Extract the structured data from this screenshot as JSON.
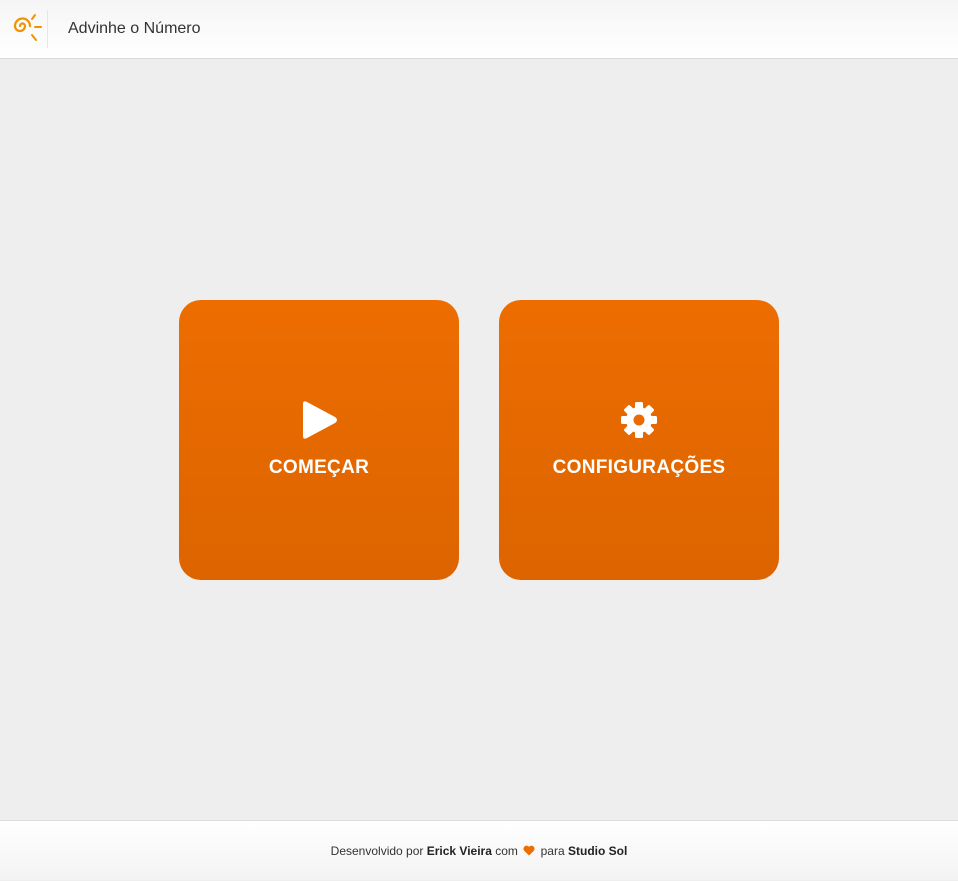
{
  "header": {
    "logo_icon": "sun-spiral-logo-icon",
    "title": "Advinhe o Número"
  },
  "main": {
    "tiles": [
      {
        "icon": "play-icon",
        "label": "COMEÇAR"
      },
      {
        "icon": "gear-icon",
        "label": "CONFIGURAÇÕES"
      }
    ]
  },
  "footer": {
    "prefix": "Desenvolvido por",
    "author": "Erick Vieira",
    "with": "com",
    "heart_icon": "heart-icon",
    "for": "para",
    "company": "Studio Sol"
  },
  "colors": {
    "accent": "#ED6D00",
    "accent_dark": "#DD6400",
    "background": "#EEEEEE",
    "logo": "#F39200"
  }
}
